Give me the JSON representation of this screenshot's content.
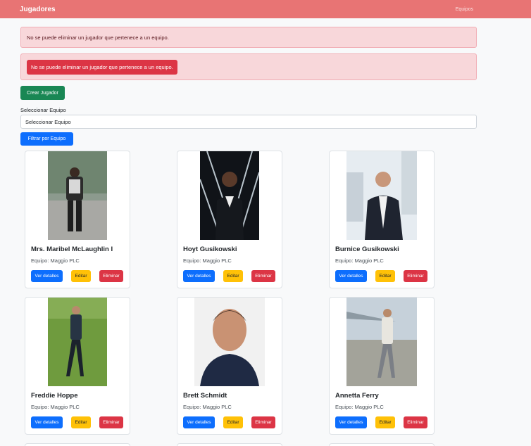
{
  "navbar": {
    "brand": "Jugadores",
    "link": "Equipos"
  },
  "alerts": {
    "first": "No se puede eliminar un jugador que pertenece a un equipo.",
    "second": "No se puede eliminar un jugador que pertenece a un equipo."
  },
  "actions": {
    "create_label": "Crear Jugador",
    "select_label": "Seleccionar Equipo",
    "select_value": "Seleccionar Equipo",
    "filter_label": "Filtrar por Equipo"
  },
  "players": [
    {
      "name": "Mrs. Maribel McLaughlin I",
      "team": "Equipo: Maggio PLC",
      "view": "Ver detalles",
      "edit": "Editar",
      "delete": "Eliminar"
    },
    {
      "name": "Hoyt Gusikowski",
      "team": "Equipo: Maggio PLC",
      "view": "Ver detalles",
      "edit": "Editar",
      "delete": "Eliminar"
    },
    {
      "name": "Burnice Gusikowski",
      "team": "Equipo: Maggio PLC",
      "view": "Ver detalles",
      "edit": "Editar",
      "delete": "Eliminar"
    },
    {
      "name": "Freddie Hoppe",
      "team": "Equipo: Maggio PLC",
      "view": "Ver detalles",
      "edit": "Editar",
      "delete": "Eliminar"
    },
    {
      "name": "Brett Schmidt",
      "team": "Equipo: Maggio PLC",
      "view": "Ver detalles",
      "edit": "Editar",
      "delete": "Eliminar"
    },
    {
      "name": "Annetta Ferry",
      "team": "Equipo: Maggio PLC",
      "view": "Ver detalles",
      "edit": "Editar",
      "delete": "Eliminar"
    }
  ]
}
